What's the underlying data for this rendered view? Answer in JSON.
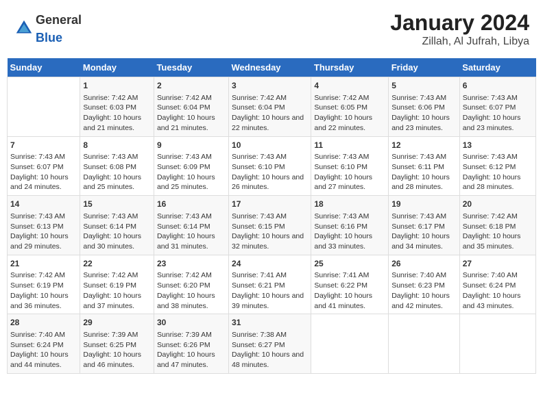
{
  "header": {
    "logo_general": "General",
    "logo_blue": "Blue",
    "title": "January 2024",
    "subtitle": "Zillah, Al Jufrah, Libya"
  },
  "calendar": {
    "days_header": [
      "Sunday",
      "Monday",
      "Tuesday",
      "Wednesday",
      "Thursday",
      "Friday",
      "Saturday"
    ],
    "weeks": [
      [
        {
          "day": "",
          "content": ""
        },
        {
          "day": "1",
          "content": "Sunrise: 7:42 AM\nSunset: 6:03 PM\nDaylight: 10 hours and 21 minutes."
        },
        {
          "day": "2",
          "content": "Sunrise: 7:42 AM\nSunset: 6:04 PM\nDaylight: 10 hours and 21 minutes."
        },
        {
          "day": "3",
          "content": "Sunrise: 7:42 AM\nSunset: 6:04 PM\nDaylight: 10 hours and 22 minutes."
        },
        {
          "day": "4",
          "content": "Sunrise: 7:42 AM\nSunset: 6:05 PM\nDaylight: 10 hours and 22 minutes."
        },
        {
          "day": "5",
          "content": "Sunrise: 7:43 AM\nSunset: 6:06 PM\nDaylight: 10 hours and 23 minutes."
        },
        {
          "day": "6",
          "content": "Sunrise: 7:43 AM\nSunset: 6:07 PM\nDaylight: 10 hours and 23 minutes."
        }
      ],
      [
        {
          "day": "7",
          "content": "Sunrise: 7:43 AM\nSunset: 6:07 PM\nDaylight: 10 hours and 24 minutes."
        },
        {
          "day": "8",
          "content": "Sunrise: 7:43 AM\nSunset: 6:08 PM\nDaylight: 10 hours and 25 minutes."
        },
        {
          "day": "9",
          "content": "Sunrise: 7:43 AM\nSunset: 6:09 PM\nDaylight: 10 hours and 25 minutes."
        },
        {
          "day": "10",
          "content": "Sunrise: 7:43 AM\nSunset: 6:10 PM\nDaylight: 10 hours and 26 minutes."
        },
        {
          "day": "11",
          "content": "Sunrise: 7:43 AM\nSunset: 6:10 PM\nDaylight: 10 hours and 27 minutes."
        },
        {
          "day": "12",
          "content": "Sunrise: 7:43 AM\nSunset: 6:11 PM\nDaylight: 10 hours and 28 minutes."
        },
        {
          "day": "13",
          "content": "Sunrise: 7:43 AM\nSunset: 6:12 PM\nDaylight: 10 hours and 28 minutes."
        }
      ],
      [
        {
          "day": "14",
          "content": "Sunrise: 7:43 AM\nSunset: 6:13 PM\nDaylight: 10 hours and 29 minutes."
        },
        {
          "day": "15",
          "content": "Sunrise: 7:43 AM\nSunset: 6:14 PM\nDaylight: 10 hours and 30 minutes."
        },
        {
          "day": "16",
          "content": "Sunrise: 7:43 AM\nSunset: 6:14 PM\nDaylight: 10 hours and 31 minutes."
        },
        {
          "day": "17",
          "content": "Sunrise: 7:43 AM\nSunset: 6:15 PM\nDaylight: 10 hours and 32 minutes."
        },
        {
          "day": "18",
          "content": "Sunrise: 7:43 AM\nSunset: 6:16 PM\nDaylight: 10 hours and 33 minutes."
        },
        {
          "day": "19",
          "content": "Sunrise: 7:43 AM\nSunset: 6:17 PM\nDaylight: 10 hours and 34 minutes."
        },
        {
          "day": "20",
          "content": "Sunrise: 7:42 AM\nSunset: 6:18 PM\nDaylight: 10 hours and 35 minutes."
        }
      ],
      [
        {
          "day": "21",
          "content": "Sunrise: 7:42 AM\nSunset: 6:19 PM\nDaylight: 10 hours and 36 minutes."
        },
        {
          "day": "22",
          "content": "Sunrise: 7:42 AM\nSunset: 6:19 PM\nDaylight: 10 hours and 37 minutes."
        },
        {
          "day": "23",
          "content": "Sunrise: 7:42 AM\nSunset: 6:20 PM\nDaylight: 10 hours and 38 minutes."
        },
        {
          "day": "24",
          "content": "Sunrise: 7:41 AM\nSunset: 6:21 PM\nDaylight: 10 hours and 39 minutes."
        },
        {
          "day": "25",
          "content": "Sunrise: 7:41 AM\nSunset: 6:22 PM\nDaylight: 10 hours and 41 minutes."
        },
        {
          "day": "26",
          "content": "Sunrise: 7:40 AM\nSunset: 6:23 PM\nDaylight: 10 hours and 42 minutes."
        },
        {
          "day": "27",
          "content": "Sunrise: 7:40 AM\nSunset: 6:24 PM\nDaylight: 10 hours and 43 minutes."
        }
      ],
      [
        {
          "day": "28",
          "content": "Sunrise: 7:40 AM\nSunset: 6:24 PM\nDaylight: 10 hours and 44 minutes."
        },
        {
          "day": "29",
          "content": "Sunrise: 7:39 AM\nSunset: 6:25 PM\nDaylight: 10 hours and 46 minutes."
        },
        {
          "day": "30",
          "content": "Sunrise: 7:39 AM\nSunset: 6:26 PM\nDaylight: 10 hours and 47 minutes."
        },
        {
          "day": "31",
          "content": "Sunrise: 7:38 AM\nSunset: 6:27 PM\nDaylight: 10 hours and 48 minutes."
        },
        {
          "day": "",
          "content": ""
        },
        {
          "day": "",
          "content": ""
        },
        {
          "day": "",
          "content": ""
        }
      ]
    ]
  }
}
